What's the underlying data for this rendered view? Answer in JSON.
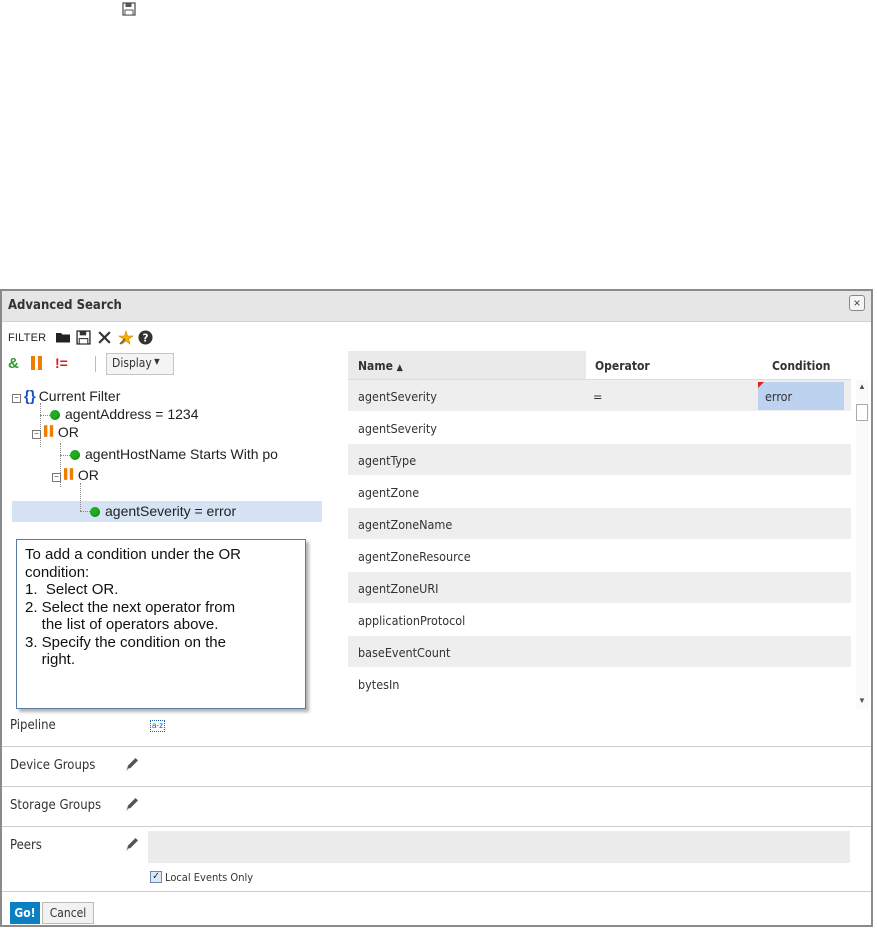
{
  "icons": {
    "top_save": "save-icon",
    "filter_bar": [
      "folder-icon",
      "save-icon",
      "close-icon",
      "wizard-icon",
      "help-icon"
    ],
    "operators": [
      "and-icon",
      "or-icon",
      "not-icon"
    ]
  },
  "dialog": {
    "title": "Advanced Search",
    "close_glyph": "×"
  },
  "filter_bar": {
    "label": "FILTER"
  },
  "ops_bar": {
    "and_label": "&",
    "or_label": "||",
    "not_label": "!=",
    "display_label": "Display"
  },
  "tree": {
    "root": "Current Filter",
    "nodes": [
      "agentAddress = 1234",
      "OR",
      "agentHostName Starts With po",
      "OR",
      "agentSeverity = error"
    ]
  },
  "tooltip": {
    "lines": [
      "To add a condition under the OR",
      "condition:",
      "1.  Select OR.",
      "2. Select the next operator from",
      "    the list of operators above.",
      "3. Specify the condition on the",
      "    right."
    ]
  },
  "grid": {
    "columns": [
      "Name",
      "Operator",
      "Condition"
    ],
    "sort_indicator": "▲",
    "rows": [
      {
        "name": "agentSeverity",
        "operator": "=",
        "condition": "error"
      },
      {
        "name": "agentSeverity",
        "operator": "",
        "condition": ""
      },
      {
        "name": "agentType",
        "operator": "",
        "condition": ""
      },
      {
        "name": "agentZone",
        "operator": "",
        "condition": ""
      },
      {
        "name": "agentZoneName",
        "operator": "",
        "condition": ""
      },
      {
        "name": "agentZoneResource",
        "operator": "",
        "condition": ""
      },
      {
        "name": "agentZoneURI",
        "operator": "",
        "condition": ""
      },
      {
        "name": "applicationProtocol",
        "operator": "",
        "condition": ""
      },
      {
        "name": "baseEventCount",
        "operator": "",
        "condition": ""
      },
      {
        "name": "bytesIn",
        "operator": "",
        "condition": ""
      }
    ]
  },
  "sections": {
    "pipeline": "Pipeline",
    "pipeline_icon_text": "a-z",
    "device_groups": "Device Groups",
    "storage_groups": "Storage Groups",
    "peers": "Peers",
    "peers_value": ""
  },
  "local_events": {
    "label": "Local Events Only",
    "checked": true
  },
  "buttons": {
    "go": "Go!",
    "cancel": "Cancel"
  },
  "colors": {
    "go_button": "#0a7fc4",
    "selected_row": "#d5e3f5",
    "condition_cell": "#bcd2ee",
    "node_dot": "#1fae1f",
    "or_icon": "#f07d00"
  }
}
